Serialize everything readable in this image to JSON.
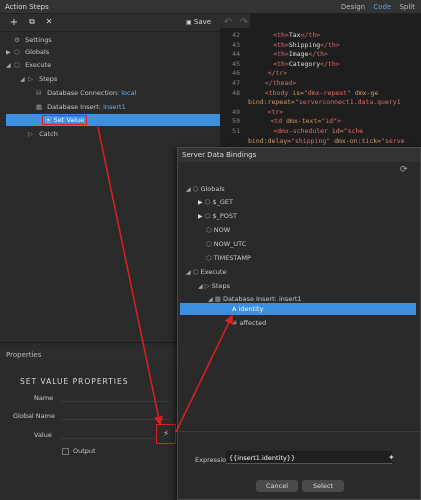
{
  "title_bar": {
    "title": "Action Steps",
    "views": [
      "Design",
      "Code",
      "Split"
    ]
  },
  "toolbar": {
    "save_label": "Save"
  },
  "tree": {
    "settings": "Settings",
    "globals": "Globals",
    "execute": "Execute",
    "steps": "Steps",
    "db_connection_label": "Database Connection:",
    "db_connection_value": "local",
    "db_insert_label": "Database Insert:",
    "db_insert_value": "insert1",
    "set_value": "Set Value",
    "catch": "Catch"
  },
  "properties": {
    "header": "Properties",
    "section_title": "SET VALUE PROPERTIES",
    "name_label": "Name",
    "global_name_label": "Global Name",
    "value_label": "Value",
    "output_label": "Output"
  },
  "code": {
    "lines": [
      {
        "n": "42",
        "html": "<span class='tag'>&lt;th&gt;</span><span class='txt'>Tax</span><span class='tag'>&lt;/th&gt;</span>",
        "indent": 72
      },
      {
        "n": "43",
        "html": "<span class='tag'>&lt;th&gt;</span><span class='txt'>Shipping</span><span class='tag'>&lt;/th&gt;</span>",
        "indent": 72
      },
      {
        "n": "44",
        "html": "<span class='tag'>&lt;th&gt;</span><span class='txt'>Image</span><span class='tag'>&lt;/th&gt;</span>",
        "indent": 72
      },
      {
        "n": "45",
        "html": "<span class='tag'>&lt;th&gt;</span><span class='txt'>Category</span><span class='tag'>&lt;/th&gt;</span>",
        "indent": 72
      },
      {
        "n": "46",
        "html": "<span class='tag'>&lt;/tr&gt;</span>",
        "indent": 56
      },
      {
        "n": "47",
        "html": "<span class='tag'>&lt;/thead&gt;</span>",
        "indent": 48
      },
      {
        "n": "48",
        "html": "<span class='tag'>&lt;tbody</span> <span class='attr'>is=</span><span class='str'>\"dmx-repeat\"</span> <span class='attr'>dmx-ge</span>",
        "indent": 48
      },
      {
        "n": "",
        "html": "<span class='attr'>bind:repeat=</span><span class='str'>\"serverconnect1.data.query1</span>",
        "indent": 0
      },
      {
        "n": "49",
        "html": "<span class='tag'>&lt;tr&gt;</span>",
        "indent": 56
      },
      {
        "n": "50",
        "html": "<span class='tag'>&lt;td</span> <span class='attr'>dmx-text=</span><span class='str'>\"id\"</span><span class='tag'>&gt;</span>",
        "indent": 64
      },
      {
        "n": "51",
        "html": "<span class='tag'>&lt;dmx-scheduler</span> <span class='attr'>id=</span><span class='str'>\"sche</span>",
        "indent": 72
      },
      {
        "n": "",
        "html": "<span class='attr'>bind:delay=</span><span class='str'>\"shipping\"</span> <span class='attr'>dmx-on:tick=</span><span class='str'>\"serve</span>",
        "indent": 0
      }
    ]
  },
  "dialog": {
    "title": "Server Data Bindings",
    "tree": {
      "globals": "Globals",
      "get": "$_GET",
      "post": "$_POST",
      "now": "NOW",
      "now_utc": "NOW_UTC",
      "timestamp": "TIMESTAMP",
      "execute": "Execute",
      "steps": "Steps",
      "db_insert_label": "Database Insert:",
      "db_insert_value": "insert1",
      "identity": "identity",
      "affected": "affected"
    },
    "expression_label": "Expression",
    "expression_value": "{{insert1.identity}}",
    "cancel_label": "Cancel",
    "select_label": "Select"
  },
  "icons": {
    "add": "+",
    "copy": "⧉",
    "delete": "✕",
    "save": "💾",
    "undo": "↶",
    "redo": "↷",
    "refresh": "⟳",
    "wand": "✨"
  },
  "colors": {
    "accent": "#3d8fe0",
    "highlight_box": "#e02020",
    "active_view": "#4aa3ff"
  }
}
